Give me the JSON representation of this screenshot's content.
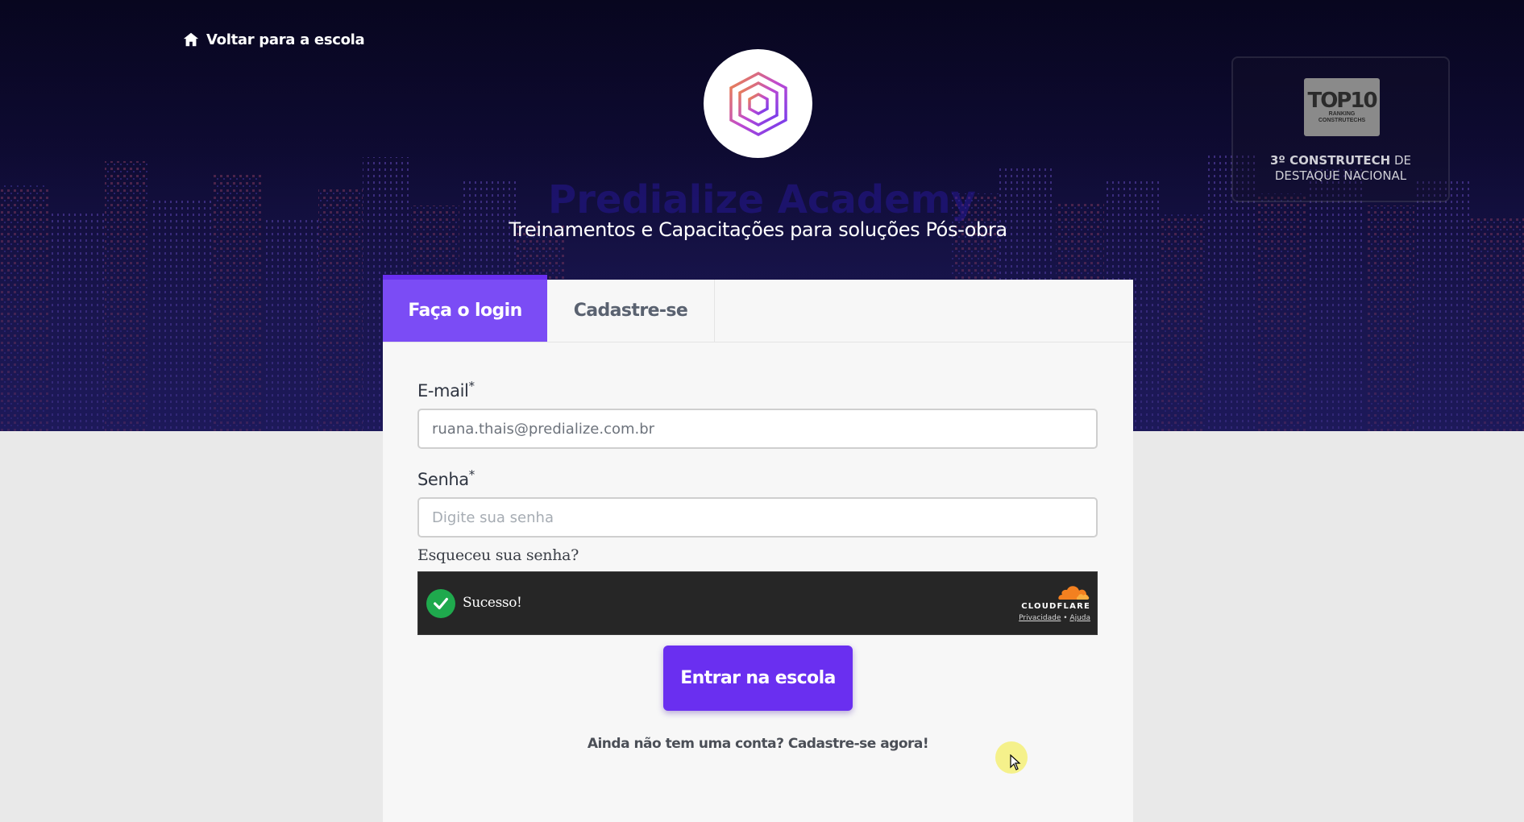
{
  "nav": {
    "back_label": "Voltar para a escola"
  },
  "header": {
    "school_name": "Predialize Academy",
    "tagline": "Treinamentos e Capacitações para soluções Pós-obra"
  },
  "award": {
    "badge_title": "TOP10",
    "badge_sub1": "RANKING",
    "badge_sub2": "CONSTRUTECHS",
    "line1_bold": "3º CONSTRUTECH",
    "line1_rest": " DE",
    "line2": "DESTAQUE NACIONAL"
  },
  "tabs": [
    {
      "label": "Faça o login",
      "active": true
    },
    {
      "label": "Cadastre-se",
      "active": false
    }
  ],
  "form": {
    "email_label": "E-mail",
    "email_value": "ruana.thais@predialize.com.br",
    "password_label": "Senha",
    "password_placeholder": "Digite sua senha",
    "required_mark": "*",
    "forgot_link": "Esqueceu sua senha?",
    "submit_label": "Entrar na escola",
    "signup_prompt": "Ainda não tem uma conta? Cadastre-se agora!"
  },
  "captcha": {
    "status": "Sucesso!",
    "brand": "CLOUDFLARE",
    "privacy": "Privacidade",
    "separator": " • ",
    "help": "Ajuda"
  },
  "colors": {
    "accent": "#6a2ff0",
    "tab_active": "#7b4cf5",
    "hero_dark": "#08061f",
    "success": "#1fa94d"
  },
  "icons": [
    "home-icon",
    "predialize-logo",
    "checkmark-icon",
    "cloudflare-icon",
    "mouse-pointer-icon"
  ]
}
